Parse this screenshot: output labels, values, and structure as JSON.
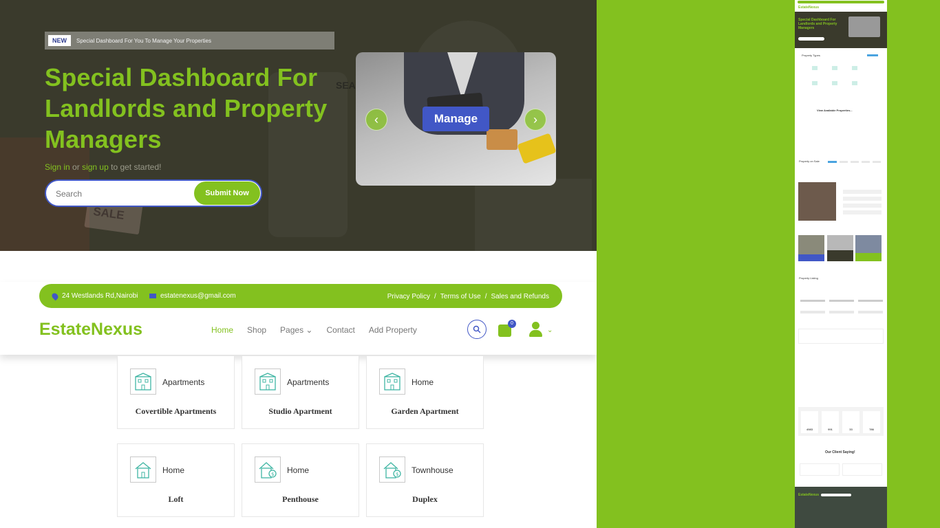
{
  "hero": {
    "badge": "NEW",
    "announcement": "Special Dashboard For You To Manage Your Properties",
    "title": "Special Dashboard For Landlords and Property Managers",
    "signin": "Sign in",
    "or": "or",
    "signup": "sign up",
    "get_started": "to get started!",
    "search_placeholder": "Search",
    "submit": "Submit Now",
    "slide_button": "Manage",
    "sale_sign": "SALE",
    "sea_sign": "SEA"
  },
  "topbar": {
    "address": "24 Westlands Rd,Nairobi",
    "email": "estatenexus@gmail.com",
    "links": [
      "Privacy Policy",
      "Terms of Use",
      "Sales and Refunds"
    ],
    "separator": "/"
  },
  "nav": {
    "logo": "EstateNexus",
    "items": [
      "Home",
      "Shop",
      "Pages",
      "Contact",
      "Add Property"
    ],
    "cart_count": "0"
  },
  "property_types": [
    {
      "category": "Apartments",
      "name": "Covertible Apartments",
      "icon": "apartment-building-icon"
    },
    {
      "category": "Apartments",
      "name": "Studio Apartment",
      "icon": "apartment-building-icon"
    },
    {
      "category": "Home",
      "name": "Garden Apartment",
      "icon": "apartment-building-icon"
    },
    {
      "category": "Home",
      "name": "Loft",
      "icon": "house-icon"
    },
    {
      "category": "Home",
      "name": "Penthouse",
      "icon": "house-dollar-icon"
    },
    {
      "category": "Townhouse",
      "name": "Duplex",
      "icon": "house-dollar-icon"
    }
  ],
  "preview": {
    "logo": "EstateNexus",
    "hero_title": "Special Dashboard For Landlords and Property Managers",
    "property_types": "Property Types",
    "view_available": "View Available Properties...",
    "property_on_sale": "Property on Sale",
    "property_listing": "Property Listing",
    "client_title": "Our Client Saying!",
    "stats": [
      "4983",
      "991",
      "33",
      "786"
    ]
  },
  "colors": {
    "brand_green": "#83c11f",
    "brand_blue": "#4157c6",
    "hero_dark": "#3a3a2c"
  }
}
